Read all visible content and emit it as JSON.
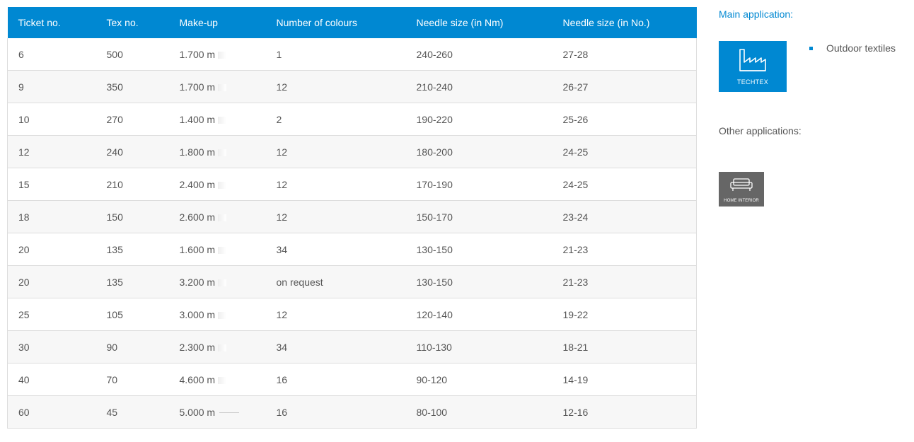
{
  "table": {
    "headers": [
      "Ticket no.",
      "Tex no.",
      "Make-up",
      "Number of colours",
      "Needle size (in Nm)",
      "Needle size (in No.)"
    ],
    "rows": [
      [
        "6",
        "500",
        "1.700 m",
        "1",
        "240-260",
        "27-28"
      ],
      [
        "9",
        "350",
        "1.700 m",
        "12",
        "210-240",
        "26-27"
      ],
      [
        "10",
        "270",
        "1.400 m",
        "2",
        "190-220",
        "25-26"
      ],
      [
        "12",
        "240",
        "1.800 m",
        "12",
        "180-200",
        "24-25"
      ],
      [
        "15",
        "210",
        "2.400 m",
        "12",
        "170-190",
        "24-25"
      ],
      [
        "18",
        "150",
        "2.600 m",
        "12",
        "150-170",
        "23-24"
      ],
      [
        "20",
        "135",
        "1.600 m",
        "34",
        "130-150",
        "21-23"
      ],
      [
        "20",
        "135",
        "3.200 m",
        "on request",
        "130-150",
        "21-23"
      ],
      [
        "25",
        "105",
        "3.000 m",
        "12",
        "120-140",
        "19-22"
      ],
      [
        "30",
        "90",
        "2.300 m",
        "34",
        "110-130",
        "18-21"
      ],
      [
        "40",
        "70",
        "4.600 m",
        "16",
        "90-120",
        "14-19"
      ],
      [
        "60",
        "45",
        "5.000 m",
        "16",
        "80-100",
        "12-16"
      ]
    ]
  },
  "sidebar": {
    "main_application_label": "Main application:",
    "main_tile": {
      "label": "TECHTEX",
      "icon": "factory-icon",
      "color": "#0088d2"
    },
    "main_items": [
      "Outdoor textiles"
    ],
    "other_applications_label": "Other applications:",
    "other_tile": {
      "label": "HOME INTERIOR",
      "icon": "sofa-icon",
      "color": "#666666"
    }
  },
  "colors": {
    "accent": "#0088d2",
    "text": "#555555",
    "border": "#dddddd",
    "stripe": "#f7f7f7"
  }
}
